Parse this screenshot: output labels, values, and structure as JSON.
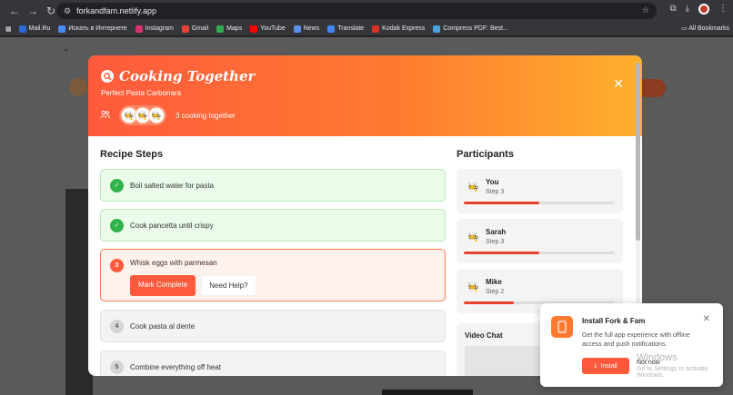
{
  "browser": {
    "url": "forkandfam.netlify.app",
    "bookmarks": [
      {
        "label": "Mail.Ru",
        "color": "#2b6cd4"
      },
      {
        "label": "Искать в Интернете",
        "color": "#4a8af4"
      },
      {
        "label": "Instagram",
        "color": "#d6336c"
      },
      {
        "label": "Gmail",
        "color": "#ea4335"
      },
      {
        "label": "Maps",
        "color": "#34a853"
      },
      {
        "label": "YouTube",
        "color": "#ff0000"
      },
      {
        "label": "News",
        "color": "#5b8df6"
      },
      {
        "label": "Translate",
        "color": "#4285f4"
      },
      {
        "label": "Kodak Express",
        "color": "#d93025"
      },
      {
        "label": "Compress PDF: Best...",
        "color": "#4aa3df"
      }
    ],
    "all_bookmarks": "All Bookmarks"
  },
  "modal": {
    "title": "Cooking Together",
    "subtitle": "Perfect Pasta Carbonara",
    "cooking_text": "3 cooking together",
    "close_icon": "close-icon",
    "steps_title": "Recipe Steps",
    "steps": [
      {
        "num": "✓",
        "text": "Boil salted water for pasta",
        "state": "done"
      },
      {
        "num": "✓",
        "text": "Cook pancetta until crispy",
        "state": "done"
      },
      {
        "num": "3",
        "text": "Whisk eggs with parmesan",
        "state": "active"
      },
      {
        "num": "4",
        "text": "Cook pasta al dente",
        "state": "todo"
      },
      {
        "num": "5",
        "text": "Combine everything off heat",
        "state": "todo"
      }
    ],
    "mark_complete": "Mark Complete",
    "need_help": "Need Help?",
    "participants_title": "Participants",
    "participants": [
      {
        "name": "You",
        "step": "Step 3",
        "progress": 0.5
      },
      {
        "name": "Sarah",
        "step": "Step 3",
        "progress": 0.5
      },
      {
        "name": "Mike",
        "step": "Step 2",
        "progress": 0.33
      }
    ],
    "video_chat": "Video Chat"
  },
  "install": {
    "title": "Install Fork & Fam",
    "description": "Get the full app experience with offline access and push notifications.",
    "install_label": "Install",
    "not_now_label": "Not now",
    "watermark": "Windows",
    "watermark2": "Go to Settings to activate Windows."
  },
  "colors": {
    "accent": "#ff5a3c",
    "done": "#2fb34a"
  }
}
